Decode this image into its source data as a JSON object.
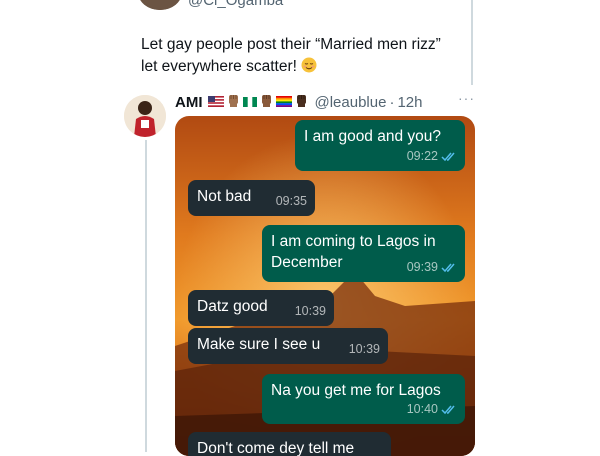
{
  "quoted_tweet": {
    "handle": "@Ci_Ogamba",
    "line1": "Let gay people post their “Married men rizz”",
    "line2": "let everywhere scatter!",
    "emoji_icon": "relieved-face-icon"
  },
  "reply": {
    "name": "AMI",
    "handle": "@leaublue",
    "separator": "·",
    "time": "12h",
    "more_label": "···"
  },
  "chat": {
    "messages": [
      {
        "direction": "out",
        "text": "I am good and you?",
        "time": "09:22",
        "read": true
      },
      {
        "direction": "in",
        "text": "Not bad",
        "time": "09:35"
      },
      {
        "direction": "out",
        "text": "I am coming to Lagos in December",
        "line1": "I am coming to Lagos in",
        "line2": "December",
        "time": "09:39",
        "read": true
      },
      {
        "direction": "in",
        "text": "Datz good",
        "time": "10:39"
      },
      {
        "direction": "in",
        "text": "Make sure I see u",
        "time": "10:39"
      },
      {
        "direction": "out",
        "text": "Na you get me for Lagos",
        "time": "10:40",
        "read": true
      },
      {
        "direction": "in",
        "text": "Don't come dey tell me"
      }
    ]
  },
  "colors": {
    "incoming_bubble": "#202c33",
    "outgoing_bubble": "#005c4b",
    "read_ticks": "#53bdeb",
    "handle_gray": "#536471"
  }
}
